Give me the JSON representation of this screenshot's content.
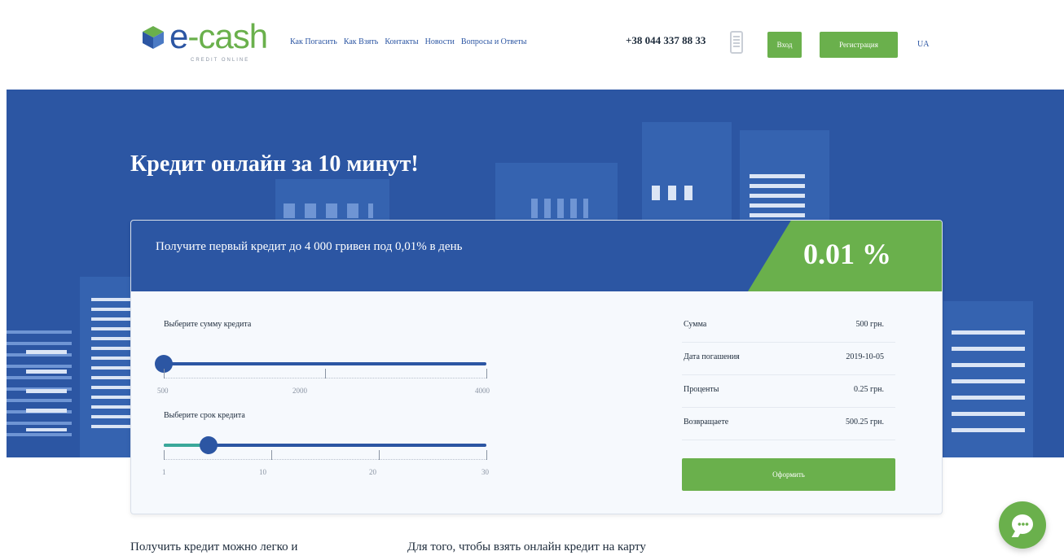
{
  "brand": {
    "name_prefix": "e",
    "name_suffix": "cash",
    "tagline": "CREDIT ONLINE"
  },
  "nav": {
    "items": [
      "Как Погасить",
      "Как Взять",
      "Контакты",
      "Новости",
      "Вопросы и Ответы"
    ]
  },
  "header": {
    "phone": "+38 044 337 88 33",
    "login_label": "Вход",
    "register_label": "Регистрация",
    "lang_label": "UA"
  },
  "hero": {
    "title": "Кредит онлайн за 10 минут!"
  },
  "calculator": {
    "headline": "Получите первый кредит до 4 000 гривен под 0,01% в день",
    "rate_badge": "0.01 %",
    "amount_slider": {
      "label": "Выберите сумму кредита",
      "min": 500,
      "max": 4000,
      "value": 500,
      "tick_labels": [
        "500",
        "2000",
        "4000"
      ]
    },
    "term_slider": {
      "label": "Выберите срок кредита",
      "min": 1,
      "max": 30,
      "value": 5,
      "tick_labels": [
        "1",
        "10",
        "20",
        "30"
      ]
    },
    "summary": [
      {
        "key": "Сумма",
        "value": "500 грн."
      },
      {
        "key": "Дата погашения",
        "value": "2019-10-05"
      },
      {
        "key": "Проценты",
        "value": "0.25 грн."
      },
      {
        "key": "Возвращаете",
        "value": "500.25 грн."
      }
    ],
    "apply_label": "Оформить"
  },
  "content": {
    "left_heading": "Получить кредит можно легко и",
    "right_heading": "Для того, чтобы взять онлайн кредит на карту"
  },
  "colors": {
    "brand_blue": "#2c56a3",
    "brand_green": "#6ab04c",
    "teal_fill": "#3aa89a"
  },
  "icons": {
    "phone": "phone-icon",
    "chat": "chat-icon",
    "logo": "cube-logo-icon"
  }
}
